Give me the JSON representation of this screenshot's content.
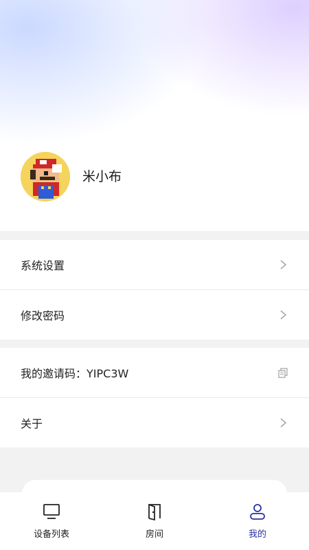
{
  "profile": {
    "name": "米小布",
    "avatar_icon": "pixel-plumber-avatar"
  },
  "menu": {
    "settings": "系统设置",
    "change_password": "修改密码",
    "invite_code": "我的邀请码：YIPC3W",
    "about": "关于"
  },
  "tabbar": {
    "tabs": [
      {
        "label": "设备列表",
        "icon": "monitor-icon"
      },
      {
        "label": "房间",
        "icon": "door-icon"
      },
      {
        "label": "我的",
        "icon": "user-icon"
      }
    ],
    "active_color": "#2b2fa3"
  }
}
